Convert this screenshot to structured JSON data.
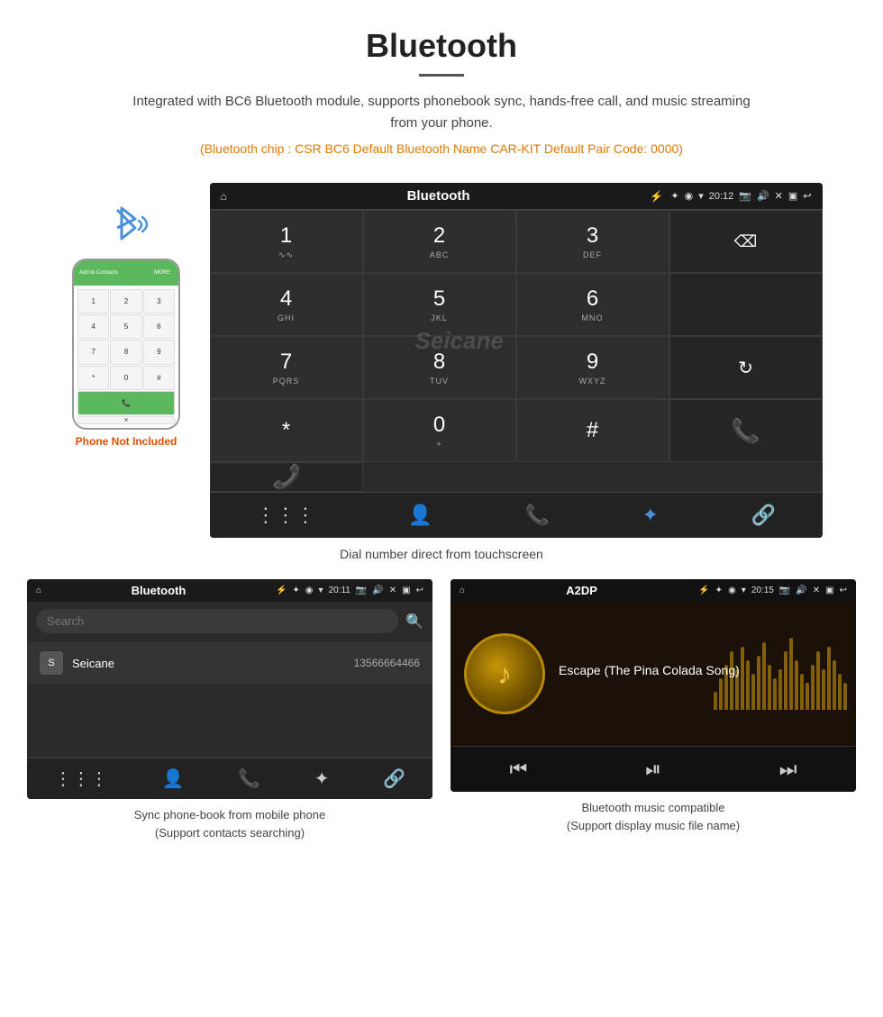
{
  "header": {
    "title": "Bluetooth",
    "description": "Integrated with BC6 Bluetooth module, supports phonebook sync, hands-free call, and music streaming from your phone.",
    "specs": "(Bluetooth chip : CSR BC6    Default Bluetooth Name CAR-KIT    Default Pair Code: 0000)"
  },
  "phone_mockup": {
    "label": "Phone Not Included",
    "top_bar_text": "Add to Contacts",
    "keys": [
      "1",
      "2",
      "3",
      "4",
      "5",
      "6",
      "7",
      "8",
      "9",
      "*",
      "0",
      "#"
    ]
  },
  "head_unit": {
    "status_bar": {
      "home_icon": "⌂",
      "title": "Bluetooth",
      "usb_icon": "⚡",
      "bt_icon": "✦",
      "location_icon": "◉",
      "wifi_icon": "▾",
      "time": "20:12",
      "cam_icon": "📷",
      "vol_icon": "🔊",
      "x_icon": "✕",
      "win_icon": "▣",
      "back_icon": "↩"
    },
    "dialpad": [
      {
        "num": "1",
        "sub": "∿∿"
      },
      {
        "num": "2",
        "sub": "ABC"
      },
      {
        "num": "3",
        "sub": "DEF"
      },
      {
        "num": "",
        "sub": "",
        "type": "empty"
      },
      {
        "num": "4",
        "sub": "GHI"
      },
      {
        "num": "5",
        "sub": "JKL"
      },
      {
        "num": "6",
        "sub": "MNO"
      },
      {
        "num": "",
        "sub": "",
        "type": "empty"
      },
      {
        "num": "7",
        "sub": "PQRS"
      },
      {
        "num": "8",
        "sub": "TUV"
      },
      {
        "num": "9",
        "sub": "WXYZ"
      },
      {
        "num": "",
        "sub": "",
        "type": "refresh"
      },
      {
        "num": "*",
        "sub": ""
      },
      {
        "num": "0",
        "sub": "+"
      },
      {
        "num": "#",
        "sub": ""
      },
      {
        "num": "",
        "sub": "",
        "type": "call-green"
      },
      {
        "num": "",
        "sub": "",
        "type": "call-red"
      }
    ],
    "bottom_icons": [
      "⋮⋮⋮",
      "👤",
      "📞",
      "✦",
      "🔗"
    ]
  },
  "dial_caption": "Dial number direct from touchscreen",
  "phonebook": {
    "status_bar": {
      "home_icon": "⌂",
      "title": "Bluetooth",
      "usb_icon": "⚡",
      "bt_icon": "✦",
      "location_icon": "◉",
      "wifi_icon": "▾",
      "time": "20:11",
      "cam_icon": "📷",
      "vol_icon": "🔊",
      "x_icon": "✕",
      "win_icon": "▣",
      "back_icon": "↩"
    },
    "search_placeholder": "Search",
    "contacts": [
      {
        "initial": "S",
        "name": "Seicane",
        "number": "13566664466"
      }
    ],
    "bottom_icons": [
      "⋮⋮⋮",
      "👤",
      "📞",
      "✦",
      "🔗"
    ],
    "caption_line1": "Sync phone-book from mobile phone",
    "caption_line2": "(Support contacts searching)"
  },
  "music": {
    "status_bar": {
      "home_icon": "⌂",
      "title": "A2DP",
      "usb_icon": "⚡",
      "bt_icon": "✦",
      "location_icon": "◉",
      "wifi_icon": "▾",
      "time": "20:15",
      "cam_icon": "📷",
      "vol_icon": "🔊",
      "x_icon": "✕",
      "win_icon": "▣",
      "back_icon": "↩"
    },
    "song_name": "Escape (The Pina Colada Song)",
    "controls": [
      "⏮",
      "⏯",
      "⏭"
    ],
    "waveform_heights": [
      20,
      35,
      50,
      65,
      45,
      70,
      55,
      40,
      60,
      75,
      50,
      35,
      45,
      65,
      80,
      55,
      40,
      30,
      50,
      65,
      45,
      70,
      55,
      40,
      30
    ],
    "caption_line1": "Bluetooth music compatible",
    "caption_line2": "(Support display music file name)"
  }
}
